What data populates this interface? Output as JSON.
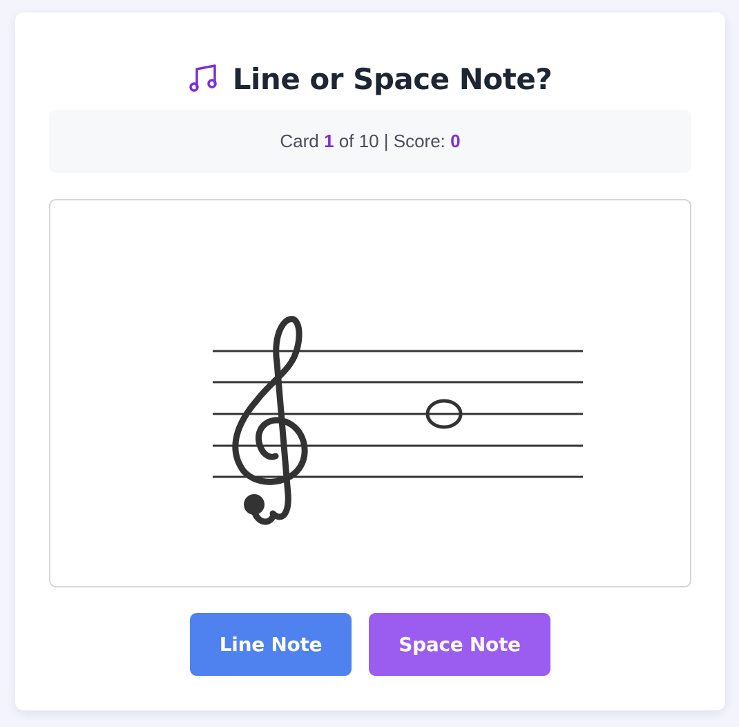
{
  "header": {
    "title": "Line or Space Note?",
    "icon": "music-note-icon"
  },
  "status": {
    "card_label": "Card",
    "current_card": "1",
    "of_label": "of 10 | Score:",
    "score": "0"
  },
  "staff": {
    "clef": "treble-clef-icon",
    "note_type": "whole-note",
    "note_position": "middle line"
  },
  "buttons": {
    "line_label": "Line Note",
    "space_label": "Space Note"
  },
  "colors": {
    "accent": "#7e2fd6",
    "line_button": "#4f82ee",
    "space_button": "#9b5cf0",
    "title": "#1f2633"
  }
}
